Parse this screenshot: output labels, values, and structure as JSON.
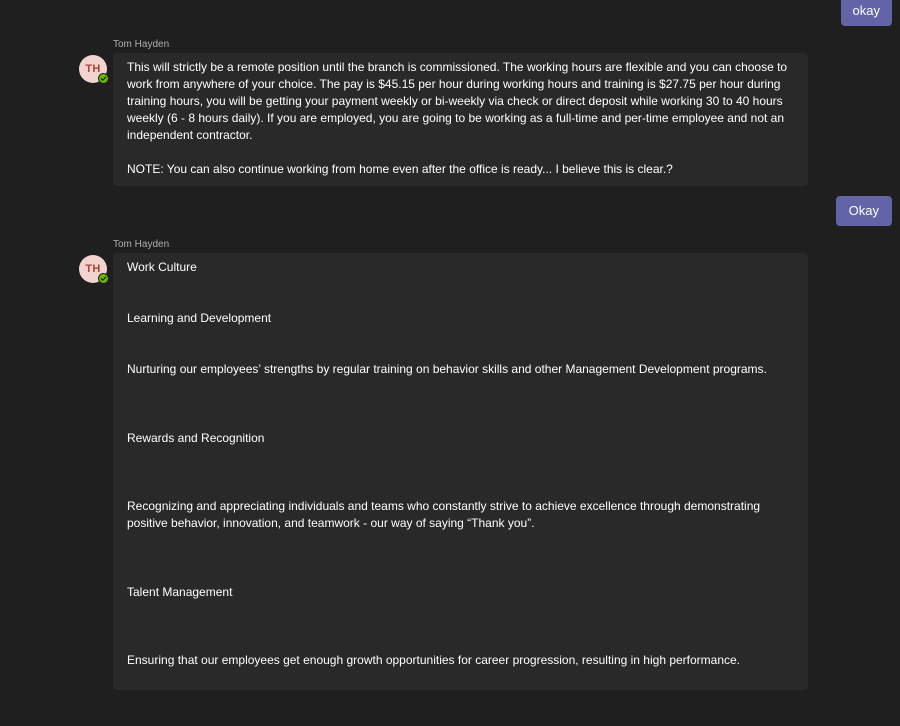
{
  "messages": {
    "outgoing_1": {
      "text": "okay"
    },
    "incoming_1": {
      "sender": "Tom Hayden",
      "avatar_initials": "TH",
      "paragraph_1": "This will strictly be a remote position until the branch is commissioned. The working hours are flexible and you can choose to work from anywhere of your choice. The pay is $45.15 per hour during working hours and training is $27.75 per hour during training hours, you will be getting your payment weekly or bi-weekly via check or direct deposit while working 30 to 40 hours weekly (6 - 8 hours daily). If you are employed, you are going to be working as a full-time and per-time employee and not an independent contractor.",
      "paragraph_2": "NOTE: You can also continue working from home even after the office is ready... I believe this is clear.?"
    },
    "outgoing_2": {
      "text": "Okay"
    },
    "incoming_2": {
      "sender": "Tom Hayden",
      "avatar_initials": "TH",
      "lines": [
        "Work Culture",
        "Learning and Development",
        "Nurturing our employees’ strengths by regular training on behavior skills and other Management Development programs.",
        "Rewards and Recognition",
        "Recognizing and appreciating individuals and teams who constantly strive to achieve excellence through demonstrating positive behavior, innovation, and teamwork - our way of saying “Thank you”.",
        "Talent Management",
        "Ensuring that our employees get enough growth opportunities for career progression, resulting in high performance."
      ]
    }
  },
  "colors": {
    "background": "#1f1f1f",
    "bubble_incoming": "#292929",
    "bubble_outgoing": "#6264a7",
    "avatar_bg": "#f3d3cf",
    "avatar_text": "#a3473b",
    "presence_available": "#6bb700"
  },
  "icons": {
    "presence": "checkmark-icon"
  }
}
